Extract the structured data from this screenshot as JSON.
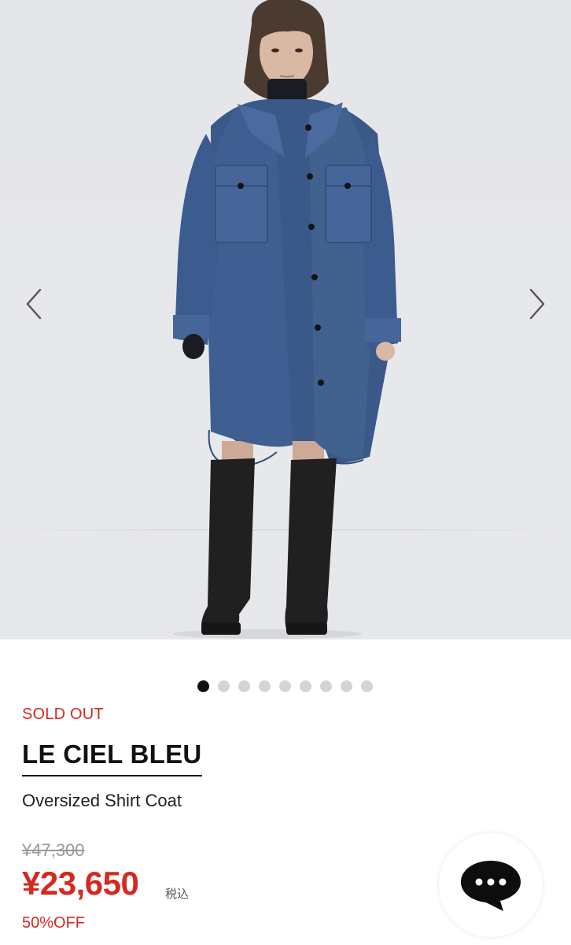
{
  "carousel": {
    "prev_icon": "chevron-left-icon",
    "next_icon": "chevron-right-icon",
    "slide_count": 9,
    "active_index": 0,
    "colors": {
      "background": "#e5e6e9",
      "coat": "#3f5f92",
      "inner_black": "#1a1c23",
      "boots": "#202020",
      "skin": "#d9b8a4",
      "hair": "#4a3a2f"
    }
  },
  "product": {
    "status": "SOLD OUT",
    "brand": "LE CIEL BLEU",
    "name": "Oversized Shirt Coat",
    "original_price": "¥47,300",
    "sale_price": "¥23,650",
    "tax_label": "税込",
    "discount": "50%OFF"
  },
  "chat": {
    "icon": "chat-bubble-icon"
  },
  "colors": {
    "accent_red": "#d5291f",
    "text_dark": "#111111",
    "muted_gray": "#999999",
    "dot_inactive": "#d4d4d4",
    "dot_active": "#111111"
  }
}
